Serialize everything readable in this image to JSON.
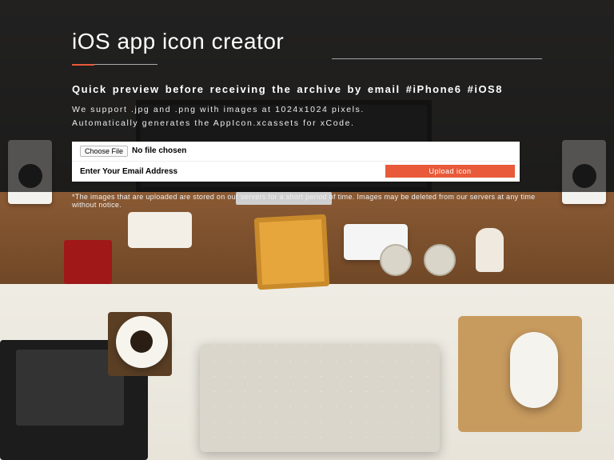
{
  "header": {
    "title": "iOS app icon creator"
  },
  "intro": {
    "subtitle": "Quick preview before receiving the archive by email #iPhone6 #iOS8",
    "support_line1": "We support .jpg and .png with images at 1024x1024 pixels.",
    "support_line2": "Automatically generates the AppIcon.xcassets for xCode."
  },
  "form": {
    "choose_file_label": "Choose File",
    "no_file_text": "No file chosen",
    "email_placeholder": "Enter Your Email Address",
    "upload_button_label": "Upload icon"
  },
  "disclaimer": "*The images that are uploaded are stored on our servers for a short period of time. Images may be deleted from our servers at any time without notice.",
  "colors": {
    "accent": "#e85a3a"
  }
}
